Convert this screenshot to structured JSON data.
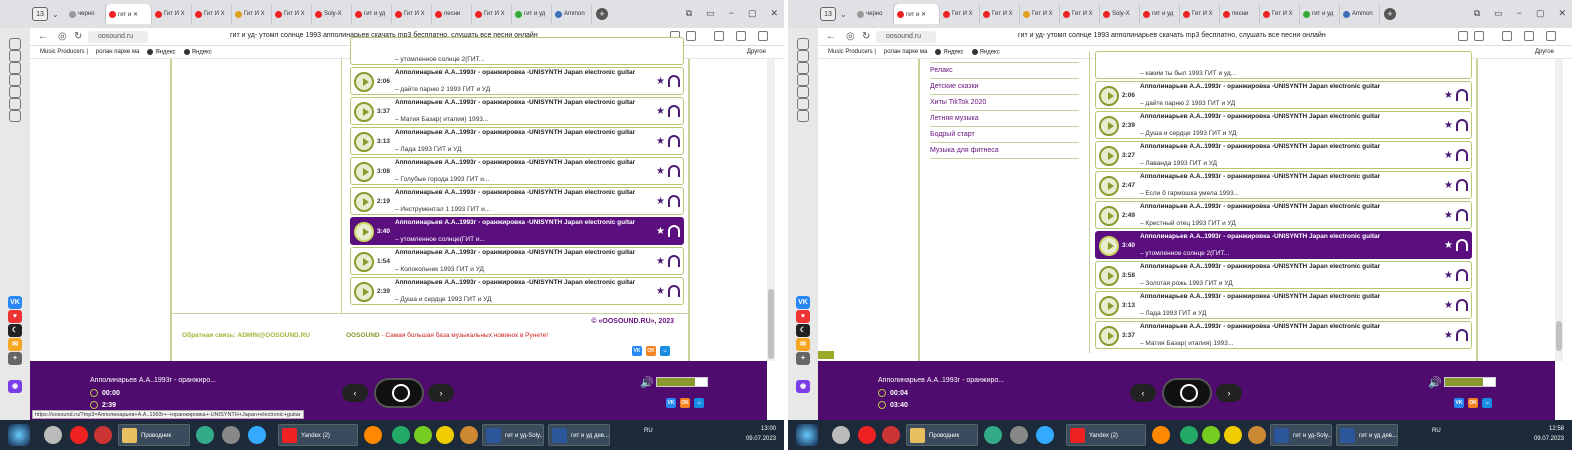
{
  "colors": {
    "brand": "#4f0b6d",
    "accent": "#8a9a2e",
    "link": "#6b1680"
  },
  "shots": [
    {
      "tabs": {
        "count": "13",
        "items": [
          "черно",
          "гит и ✕",
          "Гит И Х",
          "Гит И Х",
          "Гит И Х",
          "Гит И Х",
          "Soly-Х",
          "гит и уд",
          "Гит И Х",
          "песни",
          "Гит И Х",
          "гит и уд",
          "Ammon"
        ]
      },
      "url": "oosound.ru",
      "page_title": "гит и уд- утомл солнце 1993 апполинарьев скачать mp3 бесплатно, слушать все песни онлайн",
      "bookmarks": [
        "Music Producers |",
        "ролан парке ма",
        "Яндекс",
        "Яндекс"
      ],
      "bookmarks_other": "Другое",
      "sidebar": [],
      "top_partial": "– утомленное солнце 2(ГИТ...",
      "tracks": [
        {
          "dur": "2:06",
          "title": "Апполинарьев А.А..1993г - оранжировка -UNISYNTH Japan electronic guitar",
          "sub": "– дайте парню 2 1993 ГИТ и УД"
        },
        {
          "dur": "3:37",
          "title": "Апполинарьев А.А..1993г - оранжировка -UNISYNTH Japan electronic guitar",
          "sub": "– Матия Базар( италия) 1993..."
        },
        {
          "dur": "3:13",
          "title": "Апполинарьев А.А..1993г - оранжировка -UNISYNTH Japan electronic guitar",
          "sub": "– Лада 1993 ГИТ и УД"
        },
        {
          "dur": "3:08",
          "title": "Апполинарьев А.А..1993г - оранжировка -UNISYNTH Japan electronic guitar",
          "sub": "– Голубые города 1993 ГИТ и..."
        },
        {
          "dur": "2:19",
          "title": "Апполинарьев А.А..1993г - оранжировка -UNISYNTH Japan electronic guitar",
          "sub": "– Инструментал 1 1993 ГИТ и..."
        },
        {
          "dur": "3:40",
          "title": "Апполинарьев А.А..1993г - оранжировка -UNISYNTH Japan electronic guitar",
          "sub": "– утомленное солнце(ГИТ и...",
          "selected": true
        },
        {
          "dur": "1:54",
          "title": "Апполинарьев А.А..1993г - оранжировка -UNISYNTH Japan electronic guitar",
          "sub": "– Колокольчик 1993 ГИТ и УД"
        },
        {
          "dur": "2:39",
          "title": "Апполинарьев А.А..1993г - оранжировка -UNISYNTH Japan electronic guitar",
          "sub": "– Душа и сердце 1993 ГИТ и УД"
        }
      ],
      "footer": {
        "feedback_label": "Обратная связь:",
        "email": "ADMIN@OOSOUND.RU",
        "brand": "OOSOUND",
        "tagline": "- Самая большая база музыкальных новинок в Рунете!",
        "copyright": "© «OOSOUND.RU», 2023"
      },
      "player": {
        "song": "Апполинарьев А.А..1993г - оранжиро...",
        "time_elapsed": "00:00",
        "time_total": "2:39",
        "volume": 0.75
      },
      "tooltip": "https://oosound.ru/?mp3=Апполинарьев+А.А..1993г+-+оранжировка+-UNISYNTH+Japan+electronic+guitar",
      "taskbar": {
        "tasks": [
          "Проводник",
          "Yandex (2)",
          "гит и уд-Soly...",
          "гит и уд дев..."
        ],
        "lang": "RU",
        "time": "13:00",
        "date": "09.07.2023"
      }
    },
    {
      "tabs": {
        "count": "13",
        "items": [
          "черно",
          "гит и ✕",
          "Гит И Х",
          "Гит И Х",
          "Гит И Х",
          "Гит И Х",
          "Soly-Х",
          "гит и уд",
          "Гит И Х",
          "песни",
          "Гит И Х",
          "гит и уд",
          "Ammon"
        ]
      },
      "url": "oosound.ru",
      "page_title": "гит и уд- утомл солнце 1993 апполинарьев скачать mp3 бесплатно, слушать все песни онлайн",
      "bookmarks": [
        "Music Producers |",
        "ролан парке ма",
        "Яндекс",
        "Яндекс"
      ],
      "bookmarks_other": "Другое",
      "sidebar": [
        "Релакс",
        "Детские сказки",
        "Хиты TikTok 2020",
        "Летняя музыка",
        "Бодрый старт",
        "Музыка для фитнеса"
      ],
      "top_partial": "– каким ты был 1993 ГИТ и уд...",
      "tracks": [
        {
          "dur": "2:06",
          "title": "Апполинарьев А.А..1993г - оранжировка -UNISYNTH Japan electronic guitar",
          "sub": "– дайте парню 2 1993 ГИТ и УД"
        },
        {
          "dur": "2:39",
          "title": "Апполинарьев А.А..1993г - оранжировка -UNISYNTH Japan electronic guitar",
          "sub": "– Душа и сердце 1993 ГИТ и УД"
        },
        {
          "dur": "3:27",
          "title": "Апполинарьев А.А..1993г - оранжировка -UNISYNTH Japan electronic guitar",
          "sub": "– Лаванда 1993 ГИТ и УД"
        },
        {
          "dur": "2:47",
          "title": "Апполинарьев А.А..1993г - оранжировка -UNISYNTH Japan electronic guitar",
          "sub": "– Если б гармошка умела 1993..."
        },
        {
          "dur": "2:49",
          "title": "Апполинарьев А.А..1993г - оранжировка -UNISYNTH Japan electronic guitar",
          "sub": "– Крестный отец 1993 ГИТ и УД"
        },
        {
          "dur": "3:40",
          "title": "Апполинарьев А.А..1993г - оранжировка -UNISYNTH Japan electronic guitar",
          "sub": "– утомленное солнце 2(ГИТ...",
          "selected": true
        },
        {
          "dur": "3:58",
          "title": "Апполинарьев А.А..1993г - оранжировка -UNISYNTH Japan electronic guitar",
          "sub": "– Золотая рожь 1993 ГИТ и УД"
        },
        {
          "dur": "3:13",
          "title": "Апполинарьев А.А..1993г - оранжировка -UNISYNTH Japan electronic guitar",
          "sub": "– Лада 1993 ГИТ и УД"
        },
        {
          "dur": "3:37",
          "title": "Апполинарьев А.А..1993г - оранжировка -UNISYNTH Japan electronic guitar",
          "sub": "– Матия Базар( италия) 1993..."
        }
      ],
      "footer": null,
      "player": {
        "song": "Апполинарьев А.А..1993г - оранжиро...",
        "time_elapsed": "00:04",
        "time_total": "03:40",
        "volume": 0.75
      },
      "tooltip": "",
      "taskbar": {
        "tasks": [
          "Проводник",
          "Yandex (2)",
          "гит и уд-Soly...",
          "гит и уд дев..."
        ],
        "lang": "RU",
        "time": "12:58",
        "date": "09.07.2023"
      }
    }
  ]
}
